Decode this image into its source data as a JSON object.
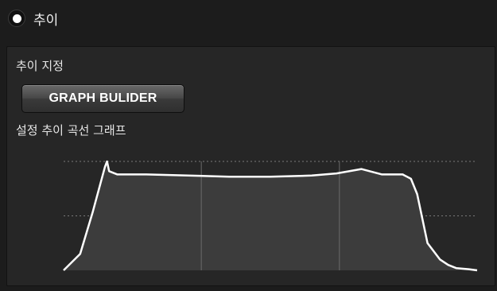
{
  "mode": {
    "label": "추이",
    "selected": true
  },
  "designation": {
    "label": "추이 지정",
    "button_label": "GRAPH BULIDER"
  },
  "graph": {
    "label": "설정 추이 곡선 그래프"
  },
  "chart_data": {
    "type": "area",
    "title": "",
    "xlabel": "",
    "ylabel": "",
    "xlim": [
      0,
      100
    ],
    "ylim": [
      0,
      100
    ],
    "y_gridlines": [
      50,
      100
    ],
    "x_gridlines": [
      33.3,
      66.7
    ],
    "grid": true,
    "x": [
      0,
      4,
      7,
      10,
      10.5,
      11,
      13,
      20,
      30,
      40,
      50,
      60,
      66,
      72,
      74,
      77,
      82,
      84,
      85.5,
      88,
      91,
      93,
      95,
      98,
      100
    ],
    "y": [
      0,
      15,
      53,
      95,
      100,
      91,
      88,
      88,
      87,
      86,
      86,
      87,
      89,
      93,
      91,
      88,
      88,
      84,
      70,
      25,
      10,
      5,
      2,
      1,
      0
    ],
    "colors": {
      "line": "#ffffff",
      "fill": "#3c3c3c",
      "grid_h": "#7a7a7a",
      "grid_v": "#6a6a6a"
    }
  }
}
